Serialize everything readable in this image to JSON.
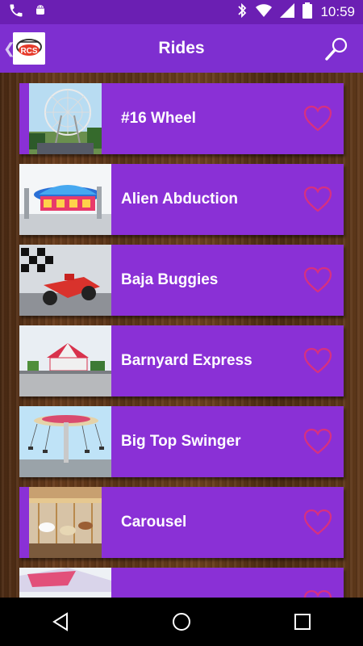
{
  "status_bar": {
    "time": "10:59",
    "icons": [
      "phone-icon",
      "android-icon",
      "bluetooth-icon",
      "wifi-icon",
      "signal-icon",
      "battery-icon"
    ]
  },
  "app_bar": {
    "title": "Rides",
    "back_glyph": "❮",
    "logo_icon": "app-logo",
    "search_icon": "search-icon"
  },
  "rides": [
    {
      "name": "#16 Wheel",
      "thumb": "ferris-wheel"
    },
    {
      "name": "Alien Abduction",
      "thumb": "alien-abduction-ride"
    },
    {
      "name": "Baja Buggies",
      "thumb": "baja-buggies-ride"
    },
    {
      "name": "Barnyard Express",
      "thumb": "barnyard-express-ride"
    },
    {
      "name": "Big Top Swinger",
      "thumb": "swing-ride"
    },
    {
      "name": "Carousel",
      "thumb": "carousel-ride"
    },
    {
      "name": "",
      "thumb": "partial-ride"
    }
  ],
  "colors": {
    "status_bar": "#6b1fb3",
    "app_bar": "#7e2fd0",
    "row_bg": "#8a30d6",
    "heart": "#d8307f"
  },
  "nav": {
    "back_icon": "nav-back-icon",
    "home_icon": "nav-home-icon",
    "recents_icon": "nav-recents-icon"
  }
}
